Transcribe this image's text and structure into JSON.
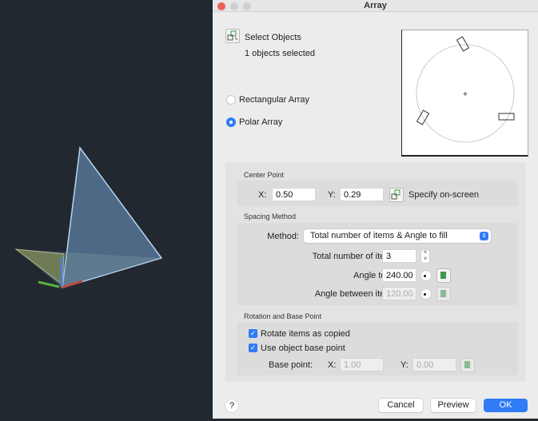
{
  "window": {
    "title": "Array"
  },
  "select": {
    "label": "Select Objects",
    "status": "1 objects selected"
  },
  "array_type": {
    "rectangular": "Rectangular Array",
    "polar": "Polar Array",
    "selected": "polar"
  },
  "center_point": {
    "title": "Center Point",
    "x_label": "X:",
    "x_value": "0.50",
    "y_label": "Y:",
    "y_value": "0.29",
    "specify": "Specify on-screen"
  },
  "spacing": {
    "title": "Spacing Method",
    "method_label": "Method:",
    "method_value": "Total number of items & Angle to fill",
    "total_label": "Total number of items:",
    "total_value": "3",
    "angle_fill_label": "Angle to fill:",
    "angle_fill_value": "240.00",
    "angle_between_label": "Angle between items:",
    "angle_between_value": "120.00"
  },
  "rotation": {
    "title": "Rotation and Base Point",
    "rotate_label": "Rotate items as copied",
    "rotate_checked": true,
    "base_label": "Use object base point",
    "base_checked": true,
    "base_point_label": "Base point:",
    "bx_label": "X:",
    "bx_value": "1.00",
    "by_label": "Y:",
    "by_value": "0.00"
  },
  "buttons": {
    "help": "?",
    "cancel": "Cancel",
    "preview": "Preview",
    "ok": "OK"
  },
  "colors": {
    "accent": "#2f7cf6",
    "canvas": "#212830"
  }
}
